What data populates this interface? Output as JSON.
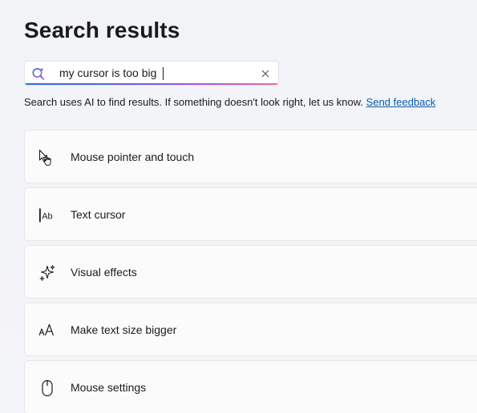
{
  "header": {
    "title": "Search results"
  },
  "search": {
    "value": "my cursor is too big",
    "clear_icon": "close-icon",
    "search_icon": "ai-search-icon"
  },
  "info": {
    "text": "Search uses AI to find results. If something doesn't look right, let us know.",
    "link_text": "Send feedback"
  },
  "results": [
    {
      "label": "Mouse pointer and touch",
      "icon": "mouse-pointer-touch-icon"
    },
    {
      "label": "Text cursor",
      "icon": "text-cursor-icon"
    },
    {
      "label": "Visual effects",
      "icon": "sparkle-icon"
    },
    {
      "label": "Make text size bigger",
      "icon": "text-size-icon"
    },
    {
      "label": "Mouse settings",
      "icon": "mouse-icon"
    }
  ],
  "colors": {
    "link": "#0b5cad",
    "accent_gradient_start": "#2a6fd8",
    "accent_gradient_end": "#e4739a"
  }
}
